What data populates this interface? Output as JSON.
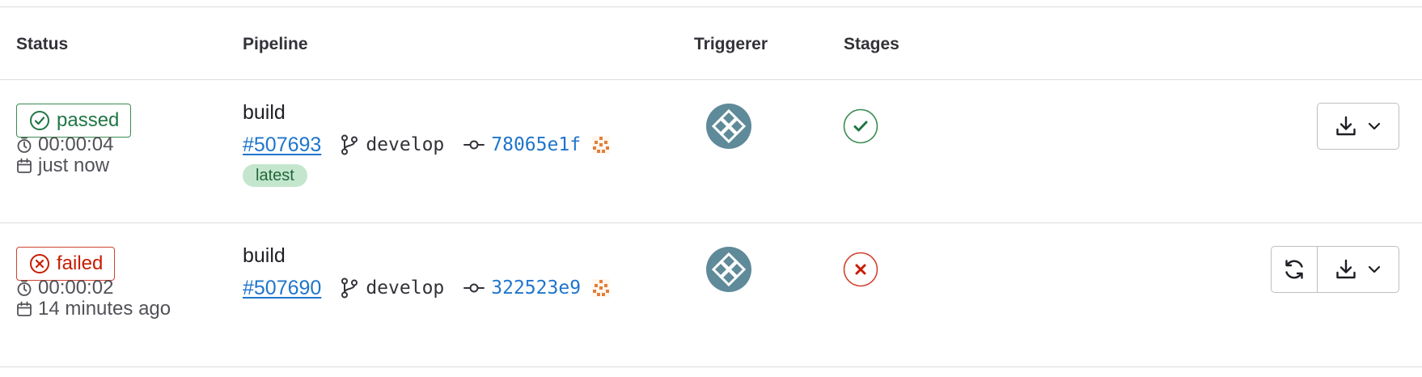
{
  "columns": {
    "status": "Status",
    "pipeline": "Pipeline",
    "triggerer": "Triggerer",
    "stages": "Stages"
  },
  "rows": [
    {
      "status": "passed",
      "duration": "00:00:04",
      "finished": "just now",
      "name": "build",
      "id": "#507693",
      "branch": "develop",
      "sha": "78065e1f",
      "tag": "latest",
      "stage_status": "success"
    },
    {
      "status": "failed",
      "duration": "00:00:02",
      "finished": "14 minutes ago",
      "name": "build",
      "id": "#507690",
      "branch": "develop",
      "sha": "322523e9",
      "stage_status": "failed"
    }
  ],
  "colors": {
    "success": "#217645",
    "danger": "#c91c00",
    "link": "#1f75cb",
    "avatar": "#5f8a99"
  },
  "icons": {
    "passed": "status-success-icon",
    "failed": "status-failed-icon",
    "duration": "timer-icon",
    "finished": "calendar-icon",
    "branch": "branch-icon",
    "commit": "commit-icon",
    "retry": "retry-icon",
    "download": "download-icon"
  }
}
